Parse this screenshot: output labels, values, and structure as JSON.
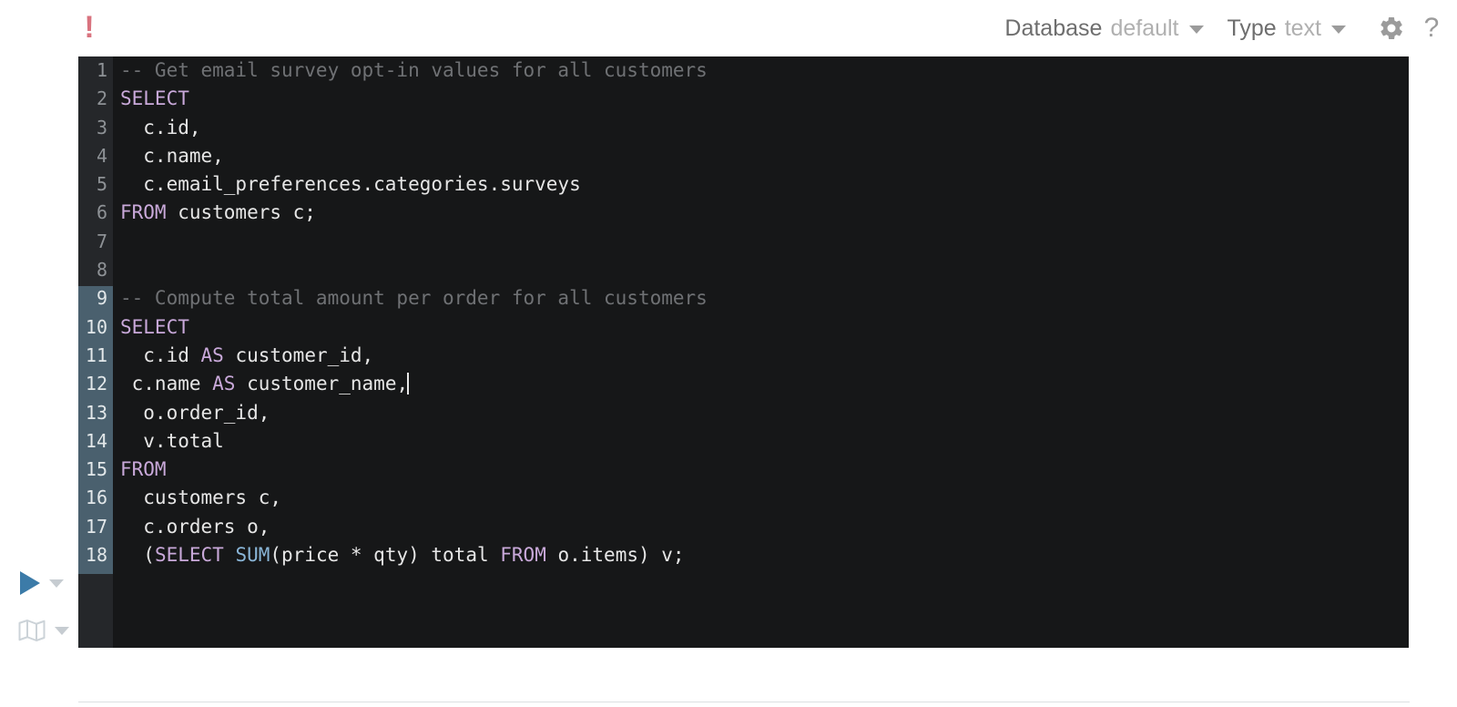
{
  "toolbar": {
    "error_marker": "!",
    "database_label": "Database",
    "database_value": "default",
    "type_label": "Type",
    "type_value": "text",
    "settings_icon": "gear-icon",
    "help_icon": "question-mark-icon",
    "database_caret": "chevron-down-icon",
    "type_caret": "chevron-down-icon",
    "help_glyph": "?"
  },
  "rail": {
    "run_icon": "play-triangle-icon",
    "run_caret": "chevron-down-icon",
    "plan_icon": "map-icon",
    "plan_caret": "chevron-down-icon"
  },
  "editor": {
    "language": "sql",
    "selected_block_start_line": 9,
    "selected_block_end_line": 18,
    "cursor_line": 12,
    "colors": {
      "background": "#161718",
      "gutter": "#25272a",
      "gutter_active": "#4a606e",
      "keyword": "#c9a9da",
      "function": "#8ab6d8",
      "comment": "#6f7174",
      "text": "#e6e6e6",
      "error": "#d9737f",
      "run_button": "#3c7ba8"
    },
    "lines": [
      {
        "n": "1",
        "sel": false,
        "tokens": [
          {
            "t": "-- Get email survey opt-in values for all customers",
            "c": "cmt"
          }
        ]
      },
      {
        "n": "2",
        "sel": false,
        "tokens": [
          {
            "t": "SELECT",
            "c": "kw"
          }
        ]
      },
      {
        "n": "3",
        "sel": false,
        "tokens": [
          {
            "t": "  c.id,",
            "c": ""
          }
        ]
      },
      {
        "n": "4",
        "sel": false,
        "tokens": [
          {
            "t": "  c.name,",
            "c": ""
          }
        ]
      },
      {
        "n": "5",
        "sel": false,
        "tokens": [
          {
            "t": "  c.email_preferences.categories.surveys",
            "c": ""
          }
        ]
      },
      {
        "n": "6",
        "sel": false,
        "tokens": [
          {
            "t": "FROM",
            "c": "kw"
          },
          {
            "t": " customers c;",
            "c": ""
          }
        ]
      },
      {
        "n": "7",
        "sel": false,
        "tokens": []
      },
      {
        "n": "8",
        "sel": false,
        "tokens": []
      },
      {
        "n": "9",
        "sel": true,
        "tokens": [
          {
            "t": "-- Compute total amount per order for all customers",
            "c": "cmt"
          }
        ]
      },
      {
        "n": "10",
        "sel": true,
        "tokens": [
          {
            "t": "SELECT",
            "c": "kw"
          }
        ]
      },
      {
        "n": "11",
        "sel": true,
        "tokens": [
          {
            "t": "  c.id ",
            "c": ""
          },
          {
            "t": "AS",
            "c": "kw"
          },
          {
            "t": " customer_id,",
            "c": ""
          }
        ]
      },
      {
        "n": "12",
        "sel": true,
        "cursor": true,
        "tokens": [
          {
            "t": " c.name ",
            "c": ""
          },
          {
            "t": "AS",
            "c": "kw"
          },
          {
            "t": " customer_name,",
            "c": ""
          }
        ]
      },
      {
        "n": "13",
        "sel": true,
        "tokens": [
          {
            "t": "  o.order_id,",
            "c": ""
          }
        ]
      },
      {
        "n": "14",
        "sel": true,
        "tokens": [
          {
            "t": "  v.total",
            "c": ""
          }
        ]
      },
      {
        "n": "15",
        "sel": true,
        "tokens": [
          {
            "t": "FROM",
            "c": "kw"
          }
        ]
      },
      {
        "n": "16",
        "sel": true,
        "tokens": [
          {
            "t": "  customers c,",
            "c": ""
          }
        ]
      },
      {
        "n": "17",
        "sel": true,
        "tokens": [
          {
            "t": "  c.orders o,",
            "c": ""
          }
        ]
      },
      {
        "n": "18",
        "sel": true,
        "tokens": [
          {
            "t": "  (",
            "c": ""
          },
          {
            "t": "SELECT",
            "c": "kw"
          },
          {
            "t": " ",
            "c": ""
          },
          {
            "t": "SUM",
            "c": "fn"
          },
          {
            "t": "(price * qty) total ",
            "c": ""
          },
          {
            "t": "FROM",
            "c": "kw"
          },
          {
            "t": " o.items) v;",
            "c": ""
          }
        ]
      }
    ]
  }
}
